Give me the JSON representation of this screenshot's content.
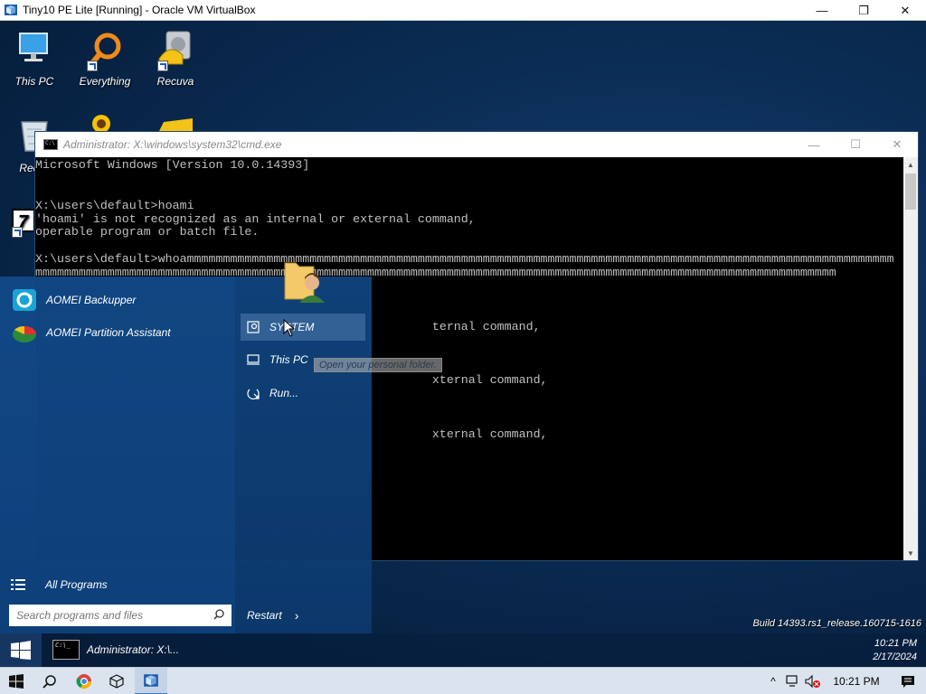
{
  "host_window": {
    "title": "Tiny10 PE Lite [Running] - Oracle VM VirtualBox",
    "minimize": "—",
    "restore": "❐",
    "close": "✕"
  },
  "desktop": {
    "icons": [
      {
        "label": "This PC",
        "icon": "computer-icon"
      },
      {
        "label": "Everything",
        "icon": "magnifier-icon"
      },
      {
        "label": "Recuva",
        "icon": "recuva-icon"
      },
      {
        "label": "Recyc",
        "icon": "recycle-bin-icon"
      },
      {
        "label": "7",
        "icon": "7zip-icon"
      }
    ]
  },
  "cmd_window": {
    "title": "Administrator: X:\\windows\\system32\\cmd.exe",
    "lines": [
      "Microsoft Windows [Version 10.0.14393]",
      "",
      "",
      "X:\\users\\default>hoami",
      "'hoami' is not recognized as an internal or external command,",
      "operable program or batch file.",
      "",
      "X:\\users\\default>whoammmmmmmmmmmmmmmmmmmmmmmmmmmmmmmmmmmmmmmmmmmmmmmmmmmmmmmmmmmmmmmmmmmmmmmmmmmmmmmmmmmmmmmmmmmmmmmmmm",
      "mmmmmmmmmmmmmmmmmmmmmmmmmmmmmmmmmmmmmmmmmmmmmmmmmmmmmmmmmmmmmmmmmmmmmmmmmmmmmmmmmmmmmmmmmmmmmmmmmmmmmmmmmmmmmmm",
      "",
      "",
      "",
      "                                                       ternal command,",
      "",
      "",
      "",
      "                                                       xternal command,",
      "",
      "",
      "",
      "                                                       xternal command,"
    ]
  },
  "start_menu": {
    "apps": [
      {
        "label": "AOMEI Backupper"
      },
      {
        "label": "AOMEI Partition Assistant"
      }
    ],
    "right_items": [
      {
        "label": "SYSTEM",
        "icon": "user-folder-icon"
      },
      {
        "label": "This PC",
        "icon": "computer-icon"
      },
      {
        "label": "Run...",
        "icon": "run-icon"
      }
    ],
    "tooltip": "Open your personal folder.",
    "all_programs": "All Programs",
    "search_placeholder": "Search programs and files",
    "restart": "Restart",
    "restart_arrow": "›"
  },
  "guest_taskbar": {
    "task_label": "Administrator: X:\\...",
    "build": "Build 14393.rs1_release.160715-1616",
    "time": "10:21 PM",
    "date": "2/17/2024"
  },
  "host_taskbar": {
    "clock": "10:21 PM",
    "tray_up": "^"
  }
}
